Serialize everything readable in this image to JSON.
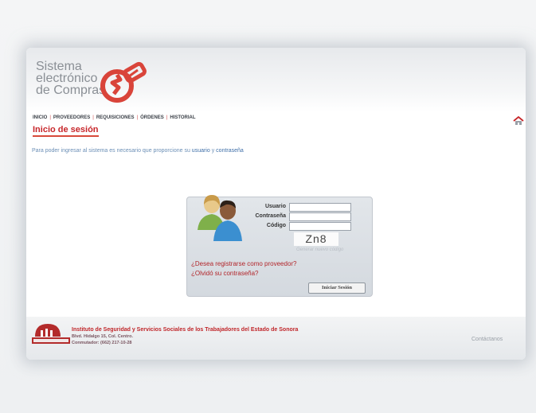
{
  "header": {
    "brand_line1": "Sistema",
    "brand_line2": "electrónico",
    "brand_line3": "de Compras"
  },
  "nav": {
    "items": [
      {
        "label": "INICIO"
      },
      {
        "label": "PROVEEDORES"
      },
      {
        "label": "REQUISICIONES"
      },
      {
        "label": "ÓRDENES"
      },
      {
        "label": "HISTORIAL"
      }
    ],
    "home_icon": "home-icon"
  },
  "main": {
    "section_title": "Inicio de sesión",
    "intro_text": "Para poder ingresar al sistema es necesario que proporcione su",
    "intro_bold1": "usuario",
    "intro_and": "y",
    "intro_bold2": "contraseña"
  },
  "login": {
    "usuario_label": "Usuario",
    "contrasena_label": "Contraseña",
    "codigo_label": "Código",
    "usuario_value": "",
    "contrasena_value": "",
    "codigo_value": "",
    "captcha_text": "Zn8",
    "regenerate_link": "Generar nuevo código",
    "register_link": "¿Desea registrarse como proveedor?",
    "forgot_link": "¿Olvidó su contraseña?",
    "submit_label": "Iniciar Sesión"
  },
  "footer": {
    "institute_name": "Instituto de Seguridad y Servicios Sociales de los Trabajadores del Estado de Sonora",
    "address": "Blvd. Hidalgo 15, Col. Centro.",
    "phone": "Conmutador: (662) 217-10-28",
    "contact_link": "Contáctanos"
  },
  "colors": {
    "accent_red": "#c7262a",
    "link_blue": "#3f6fa8"
  }
}
